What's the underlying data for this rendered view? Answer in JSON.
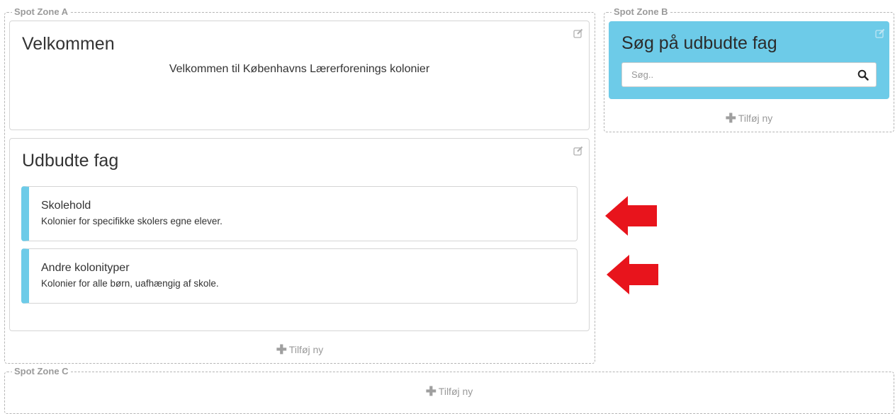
{
  "zones": {
    "a": {
      "label": "Spot Zone A",
      "add_label": "Tilføj ny"
    },
    "b": {
      "label": "Spot Zone B",
      "add_label": "Tilføj ny"
    },
    "c": {
      "label": "Spot Zone C",
      "add_label": "Tilføj ny"
    }
  },
  "welcome": {
    "title": "Velkommen",
    "text": "Velkommen til Københavns Lærerforenings kolonier"
  },
  "offered": {
    "title": "Udbudte fag",
    "items": [
      {
        "title": "Skolehold",
        "description": "Kolonier for specifikke skolers egne elever."
      },
      {
        "title": "Andre kolonityper",
        "description": "Kolonier for alle børn, uafhængig af skole."
      }
    ]
  },
  "search": {
    "title": "Søg på udbudte fag",
    "placeholder": "Søg..",
    "value": ""
  },
  "icons": {
    "edit": "edit-icon",
    "search": "search-icon",
    "add": "plus-icon",
    "arrow": "red-arrow-left-icon"
  },
  "colors": {
    "accent": "#6dcbe8",
    "arrow": "#e8141c",
    "zone_border": "#b5b5b5",
    "muted_text": "#9a9a9a"
  }
}
